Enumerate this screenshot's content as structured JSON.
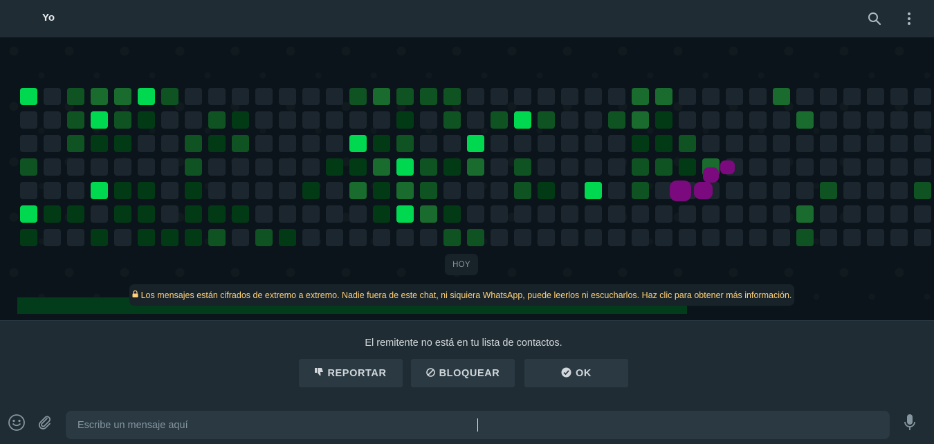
{
  "header": {
    "contact_name": "Yo",
    "search_icon": "search-icon",
    "menu_icon": "more-vertical-icon"
  },
  "chat": {
    "date_chip": "HOY",
    "encryption_notice": "Los mensajes están cifrados de extremo a extremo. Nadie fuera de este chat, ni siquiera WhatsApp, puede leerlos ni escucharlos. Haz clic para obtener más información.",
    "lock_icon": "lock-icon",
    "contribution_grid": {
      "levels_legend": [
        "#1c262e",
        "#033a16",
        "#0f5323",
        "#196c2e",
        "#00d84f"
      ],
      "rows": [
        [
          4,
          0,
          2,
          3,
          3,
          4,
          2,
          0,
          0,
          0,
          0,
          0,
          0,
          0,
          2,
          3,
          2,
          2,
          2,
          0,
          0,
          0,
          0,
          0,
          0,
          0,
          3,
          3,
          0,
          0,
          0,
          0,
          3,
          0,
          0,
          0,
          0,
          0,
          0,
          0
        ],
        [
          0,
          0,
          2,
          4,
          2,
          1,
          0,
          0,
          2,
          1,
          0,
          0,
          0,
          0,
          0,
          0,
          1,
          0,
          2,
          0,
          2,
          4,
          2,
          0,
          0,
          2,
          3,
          1,
          0,
          0,
          0,
          0,
          0,
          3,
          0,
          0,
          0,
          0,
          0,
          0
        ],
        [
          0,
          0,
          2,
          1,
          1,
          0,
          0,
          2,
          1,
          2,
          0,
          0,
          0,
          0,
          4,
          1,
          2,
          0,
          0,
          4,
          0,
          0,
          0,
          0,
          0,
          0,
          1,
          1,
          2,
          0,
          0,
          0,
          0,
          0,
          0,
          0,
          0,
          0,
          0,
          0
        ],
        [
          2,
          0,
          0,
          0,
          0,
          0,
          0,
          2,
          0,
          0,
          0,
          0,
          0,
          1,
          1,
          3,
          4,
          2,
          1,
          3,
          0,
          2,
          0,
          0,
          0,
          0,
          2,
          2,
          1,
          3,
          0,
          0,
          0,
          0,
          0,
          0,
          0,
          0,
          0,
          0
        ],
        [
          0,
          0,
          0,
          4,
          1,
          1,
          0,
          1,
          0,
          0,
          0,
          0,
          1,
          0,
          3,
          1,
          3,
          2,
          0,
          0,
          0,
          2,
          1,
          0,
          4,
          0,
          2,
          0,
          0,
          0,
          0,
          0,
          0,
          0,
          2,
          0,
          0,
          0,
          2,
          0
        ],
        [
          4,
          1,
          1,
          0,
          1,
          1,
          0,
          1,
          1,
          1,
          0,
          0,
          0,
          0,
          0,
          1,
          4,
          3,
          1,
          0,
          0,
          0,
          0,
          0,
          0,
          0,
          0,
          0,
          0,
          0,
          0,
          0,
          0,
          3,
          0,
          0,
          0,
          0,
          0,
          0
        ],
        [
          1,
          0,
          0,
          1,
          0,
          1,
          1,
          1,
          2,
          0,
          2,
          1,
          0,
          0,
          0,
          0,
          0,
          0,
          2,
          2,
          0,
          0,
          0,
          0,
          0,
          0,
          0,
          0,
          0,
          0,
          0,
          0,
          0,
          2,
          0,
          0,
          0,
          0,
          0,
          0
        ]
      ]
    }
  },
  "spam_panel": {
    "message": "El remitente no está en tu lista de contactos.",
    "report_label": "REPORTAR",
    "block_label": "BLOQUEAR",
    "ok_label": "OK"
  },
  "composer": {
    "placeholder": "Escribe un mensaje aquí",
    "emoji_icon": "emoji-icon",
    "attach_icon": "paperclip-icon",
    "mic_icon": "microphone-icon"
  },
  "colors": {
    "accent": "#00d84f",
    "notice_text": "#ffd279",
    "blob": "#7a0a7e"
  }
}
